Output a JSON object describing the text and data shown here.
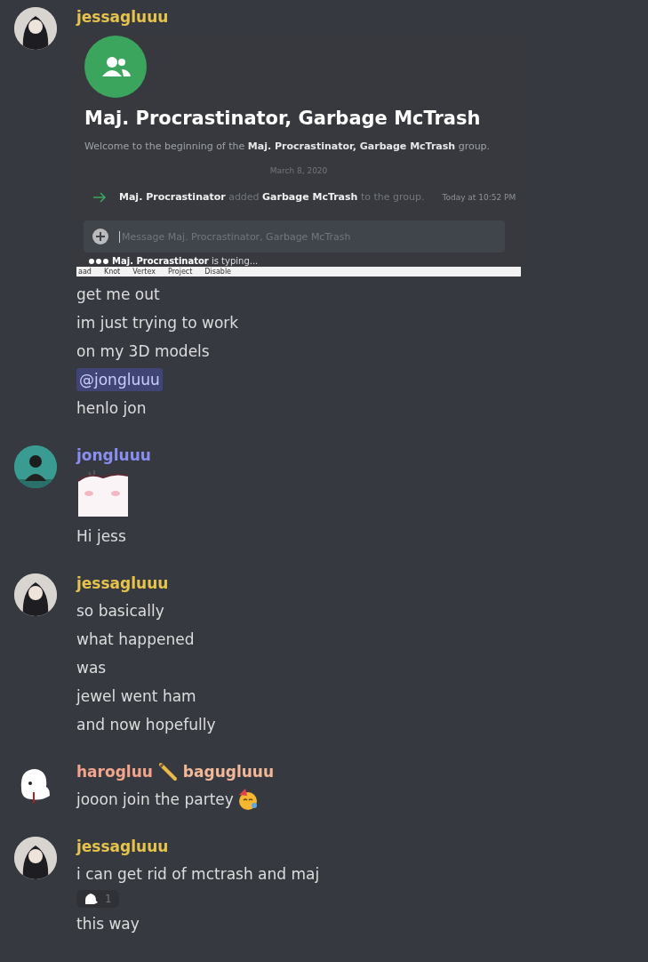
{
  "messages": [
    {
      "avatar": {
        "kind": "dark-hair"
      },
      "authors": [
        {
          "name": "jessagluuu",
          "color": "#e6c34d"
        }
      ],
      "blocks": [
        {
          "kind": "screenshot",
          "title": "Maj. Procrastinator, Garbage McTrash",
          "welcome": "Welcome to the beginning of the **Maj. Procrastinator, Garbage McTrash** group.",
          "date": "March 8, 2020",
          "system": "**Maj. Procrastinator** added **Garbage McTrash** to the group.",
          "time": "Today at 10:52 PM",
          "placeholder": "Message Maj. Procrastinator, Garbage McTrash",
          "typing": "**Maj. Procrastinator** is typing...",
          "strip": [
            "aad",
            "Knot",
            "Vertex",
            "Project",
            "Disable"
          ]
        },
        {
          "kind": "text",
          "text": "get me out"
        },
        {
          "kind": "text",
          "text": "im just trying to work"
        },
        {
          "kind": "text",
          "text": "on my 3D models"
        },
        {
          "kind": "mention",
          "text": "@jongluuu"
        },
        {
          "kind": "text",
          "text": "henlo jon"
        }
      ]
    },
    {
      "avatar": {
        "kind": "teal"
      },
      "authors": [
        {
          "name": "jongluuu",
          "color": "#8a8ef0"
        }
      ],
      "blocks": [
        {
          "kind": "sticker"
        },
        {
          "kind": "text",
          "text": "Hi jess"
        }
      ]
    },
    {
      "avatar": {
        "kind": "dark-hair"
      },
      "authors": [
        {
          "name": "jessagluuu",
          "color": "#e6c34d"
        }
      ],
      "blocks": [
        {
          "kind": "text",
          "text": "so basically"
        },
        {
          "kind": "text",
          "text": "what happened"
        },
        {
          "kind": "text",
          "text": "was"
        },
        {
          "kind": "text",
          "text": "jewel went ham"
        },
        {
          "kind": "text",
          "text": "and now hopefully"
        }
      ]
    },
    {
      "avatar": {
        "kind": "white"
      },
      "authors": [
        {
          "name": "harogluu",
          "color": "#f2a58c"
        },
        {
          "name": "bagugluuu",
          "color": "#f2b898"
        }
      ],
      "blocks": [
        {
          "kind": "text",
          "text": "jooon join the partey",
          "emoji": {
            "kind": "party"
          }
        }
      ]
    },
    {
      "avatar": {
        "kind": "dark-hair"
      },
      "authors": [
        {
          "name": "jessagluuu",
          "color": "#e6c34d"
        }
      ],
      "blocks": [
        {
          "kind": "text",
          "text": "i can get rid of mctrash and maj"
        },
        {
          "kind": "reaction",
          "count": "1"
        },
        {
          "kind": "text",
          "text": "this way"
        }
      ]
    }
  ]
}
